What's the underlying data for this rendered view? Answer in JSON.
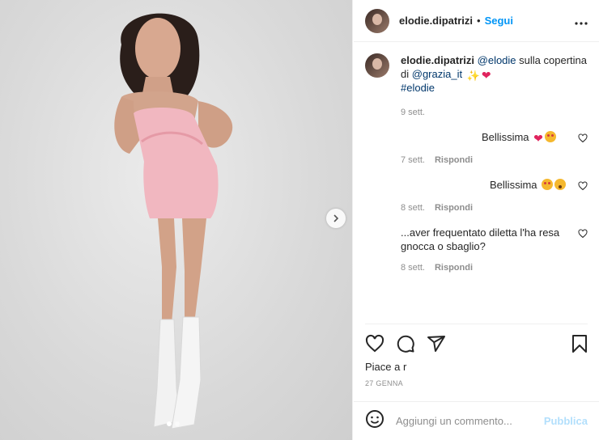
{
  "header": {
    "username": "elodie.dipatrizi",
    "separator": "•",
    "follow_label": "Segui",
    "more_icon": "more-horizontal-icon"
  },
  "caption": {
    "username": "elodie.dipatrizi",
    "mention1": "@elodie",
    "text1": "sulla copertina di",
    "mention2": "@grazia_it",
    "hashtag": "#elodie",
    "time": "9 sett."
  },
  "comments": [
    {
      "text": "Bellissima",
      "time": "7 sett.",
      "reply": "Rispondi"
    },
    {
      "text": "Bellissima",
      "time": "8 sett.",
      "reply": "Rispondi"
    },
    {
      "text": "...aver frequentato diletta l'ha resa gnocca o sbaglio?",
      "time": "8 sett.",
      "reply": "Rispondi"
    }
  ],
  "likes_text": "Piace a r",
  "date_text": "27 GENNA",
  "composer": {
    "placeholder": "Aggiungi un commento...",
    "post_label": "Pubblica"
  },
  "colors": {
    "accent": "#0095f6",
    "link": "#00376b",
    "muted": "#8e8e8e",
    "post_disabled": "#b2dffc"
  }
}
